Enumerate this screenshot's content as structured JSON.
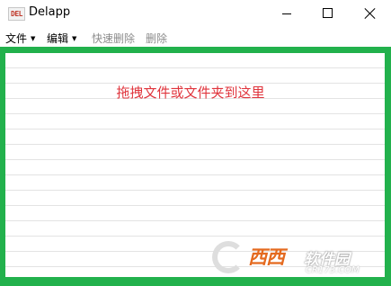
{
  "window": {
    "title": "Delapp",
    "icon_label": "DEL"
  },
  "menu": {
    "file": "文件",
    "edit": "编辑",
    "quick_delete": "快速删除",
    "delete": "删除"
  },
  "dropzone": {
    "hint": "拖拽文件或文件夹到这里",
    "border_color": "#22b14c",
    "hint_color": "#e0343c"
  },
  "watermark": {
    "brand": "西西",
    "name": "软件园",
    "url": "CR173.COM"
  }
}
